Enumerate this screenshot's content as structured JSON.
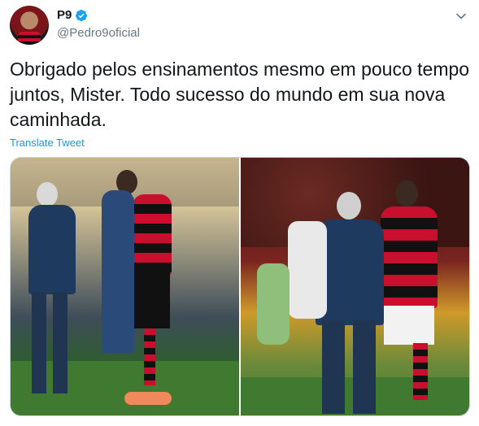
{
  "author": {
    "display_name": "P9",
    "handle": "@Pedro9oficial",
    "verified": true,
    "avatar_icon": "profile-photo"
  },
  "tweet": {
    "text": "Obrigado pelos ensinamentos mesmo em pouco tempo juntos, Mister. Todo sucesso do mundo em sua nova caminhada.",
    "translate_label": "Translate Tweet"
  },
  "icons": {
    "verified": "verified-badge-icon",
    "menu": "chevron-down-icon"
  },
  "colors": {
    "link": "#1b95e0",
    "secondary_text": "#657786",
    "verified": "#1da1f2"
  }
}
